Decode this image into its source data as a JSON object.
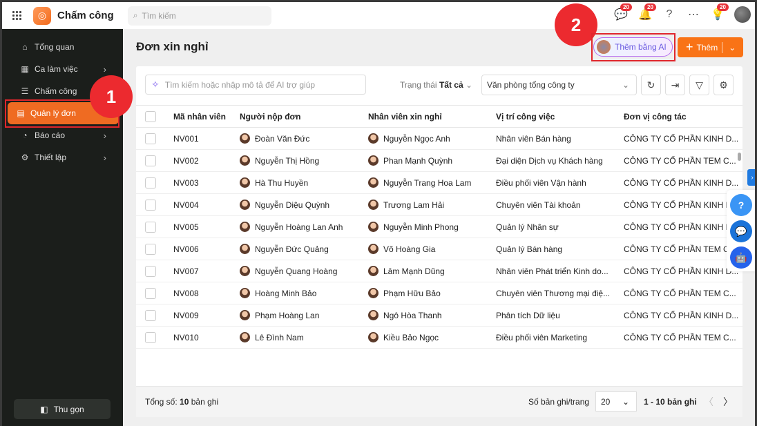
{
  "app": {
    "title": "Chấm công",
    "search_placeholder": "Tìm kiếm"
  },
  "top_icons": [
    {
      "name": "chat-icon",
      "badge": "20"
    },
    {
      "name": "bell-icon",
      "badge": "20"
    },
    {
      "name": "help-icon"
    },
    {
      "name": "more-icon"
    },
    {
      "name": "lightbulb-icon",
      "badge": "20"
    }
  ],
  "sidebar": {
    "items": [
      {
        "label": "Tổng quan",
        "icon": "home-icon"
      },
      {
        "label": "Ca làm việc",
        "icon": "calendar-icon",
        "chevron": true
      },
      {
        "label": "Chấm công",
        "icon": "checklist-icon"
      },
      {
        "label": "Quản lý đơn",
        "icon": "document-icon",
        "active": true
      },
      {
        "label": "Báo cáo",
        "icon": "pie-chart-icon",
        "chevron": true
      },
      {
        "label": "Thiết lập",
        "icon": "gear-icon",
        "chevron": true
      }
    ],
    "collapse_label": "Thu gọn"
  },
  "steps": [
    "1",
    "2"
  ],
  "page": {
    "title": "Đơn xin nghỉ",
    "ai_button": "Thêm bằng AI",
    "add_button": "Thêm"
  },
  "toolbar": {
    "ai_search_placeholder": "Tìm kiếm hoặc nhập mô tả để AI trợ giúp",
    "status_label": "Trạng thái",
    "status_value": "Tất cả",
    "office": "Văn phòng tổng công ty"
  },
  "table": {
    "headers": [
      "Mã nhân viên",
      "Người nộp đơn",
      "Nhân viên xin nghỉ",
      "Vị trí công việc",
      "Đơn vị công tác"
    ],
    "rows": [
      [
        "NV001",
        "Đoàn Văn Đức",
        "Nguyễn Ngọc Anh",
        "Nhân viên Bán hàng",
        "CÔNG TY CỔ PHẦN KINH D..."
      ],
      [
        "NV002",
        "Nguyễn Thị Hồng",
        "Phan Mạnh Quỳnh",
        "Đại diện Dịch vụ Khách hàng",
        "CÔNG TY CỔ PHẦN TEM C..."
      ],
      [
        "NV003",
        "Hà Thu Huyền",
        "Nguyễn Trang Hoa Lam",
        "Điều phối viên Vận hành",
        "CÔNG TY CỔ PHẦN KINH D..."
      ],
      [
        "NV004",
        "Nguyễn Diệu Quỳnh",
        "Trương Lam Hải",
        "Chuyên viên Tài khoản",
        "CÔNG TY CỔ PHẦN KINH D..."
      ],
      [
        "NV005",
        "Nguyễn Hoàng Lan Anh",
        "Nguyễn Minh Phong",
        "Quản lý Nhân sự",
        "CÔNG TY CỔ PHẦN KINH D..."
      ],
      [
        "NV006",
        "Nguyễn Đức Quảng",
        "Võ Hoàng Gia",
        "Quản lý Bán hàng",
        "CÔNG TY CỔ PHẦN TEM C..."
      ],
      [
        "NV007",
        "Nguyễn Quang Hoàng",
        "Lâm Mạnh Dũng",
        "Nhân viên Phát triển Kinh do...",
        "CÔNG TY CỔ PHẦN KINH D..."
      ],
      [
        "NV008",
        "Hoàng Minh Bảo",
        "Phạm Hữu Bảo",
        "Chuyên viên Thương mại điệ...",
        "CÔNG TY CỔ PHẦN TEM C..."
      ],
      [
        "NV009",
        "Phạm Hoàng Lan",
        "Ngô Hòa Thanh",
        "Phân tích Dữ liệu",
        "CÔNG TY CỔ PHẦN KINH D..."
      ],
      [
        "NV010",
        "Lê Đình Nam",
        "Kiều Bảo Ngọc",
        "Điều phối viên Marketing",
        "CÔNG TY CỔ PHẦN TEM C..."
      ]
    ]
  },
  "footer": {
    "total_prefix": "Tổng số:",
    "total_count": "10",
    "total_suffix": "bản ghi",
    "per_page_label": "Số bản ghi/trang",
    "per_page": "20",
    "range": "1 - 10 bản ghi"
  },
  "colors": {
    "accent": "#f97316",
    "sidebar": "#1b1e1b",
    "highlight": "#e0262c"
  }
}
